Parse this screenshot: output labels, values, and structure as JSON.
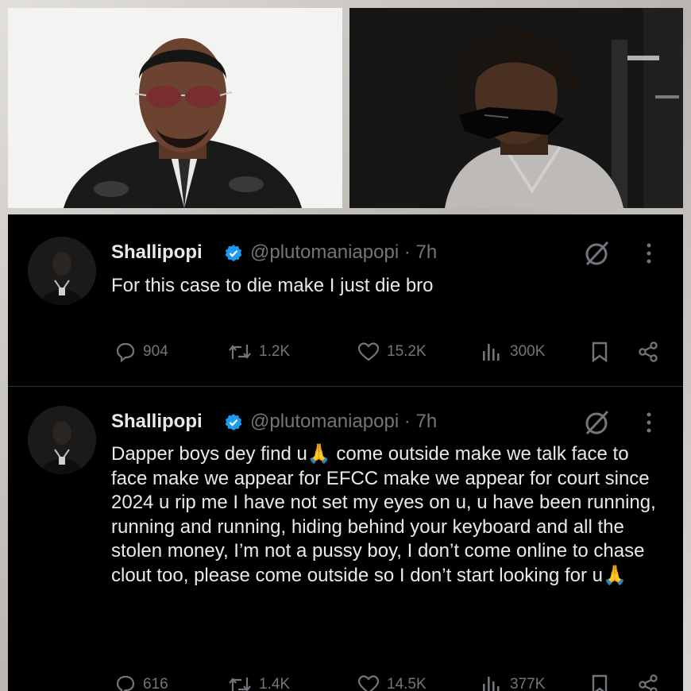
{
  "tweets": [
    {
      "name": "Shallipopi",
      "handle": "@plutomaniapopi",
      "time": "7h",
      "handle_line": "@plutomaniapopi · 7h",
      "text": "For this case to die make I just die bro",
      "replies": "904",
      "reposts": "1.2K",
      "likes": "15.2K",
      "views": "300K"
    },
    {
      "name": "Shallipopi",
      "handle": "@plutomaniapopi",
      "time": "7h",
      "handle_line": "@plutomaniapopi · 7h",
      "text": "Dapper boys dey find u🙏 come outside make we talk face to face make we appear for EFCC make we appear for court since 2024 u rip me I have not set my eyes on u, u have been running, running and running, hiding behind your keyboard and all the stolen money, I’m not a pussy boy, I don’t come online to chase clout too, please come outside so I don’t start looking for u🙏",
      "replies": "616",
      "reposts": "1.4K",
      "likes": "14.5K",
      "views": "377K"
    }
  ],
  "colors": {
    "background": "#000000",
    "text": "#e7e9ea",
    "muted": "#71767b",
    "verified": "#1d9bf0",
    "divider": "#2f3336"
  },
  "icons": [
    "verified-badge-icon",
    "grok-icon",
    "more-icon",
    "reply-icon",
    "repost-icon",
    "like-icon",
    "views-icon",
    "bookmark-icon",
    "share-icon"
  ]
}
